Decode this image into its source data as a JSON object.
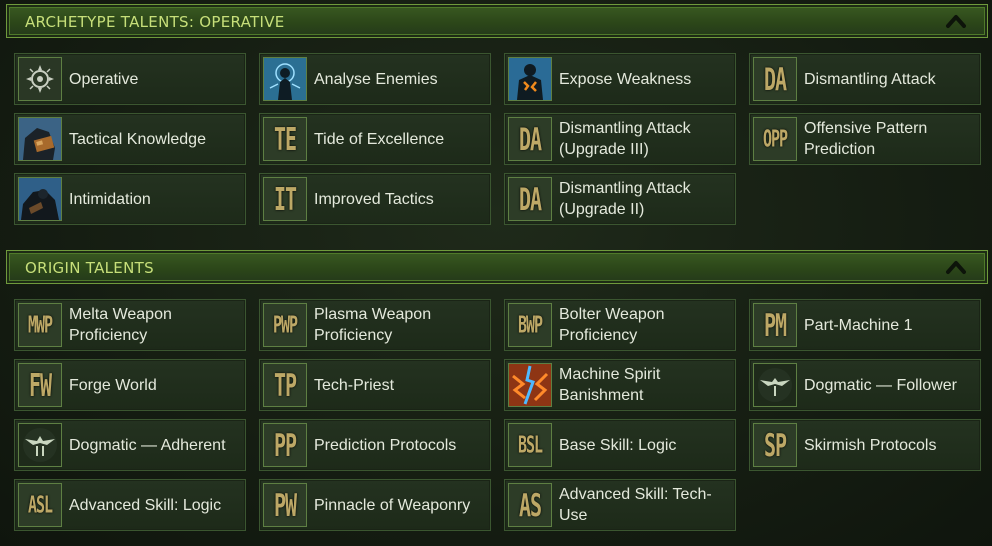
{
  "sections": [
    {
      "title": "ARCHETYPE TALENTS: OPERATIVE",
      "collapse_icon": "chevron-up-icon",
      "rows": [
        [
          {
            "label": "Operative",
            "abbr": "",
            "icon": "operative-emblem-icon"
          },
          {
            "label": "Analyse Enemies",
            "abbr": "",
            "icon": "analyse-enemies-icon"
          },
          {
            "label": "Expose Weakness",
            "abbr": "",
            "icon": "expose-weakness-icon"
          },
          {
            "label": "Dismantling Attack",
            "abbr": "DA",
            "icon": "placeholder-icon"
          }
        ],
        [
          {
            "label": "Tactical Knowledge",
            "abbr": "",
            "icon": "tactical-knowledge-icon"
          },
          {
            "label": "Tide of Excellence",
            "abbr": "TE",
            "icon": "placeholder-icon"
          },
          {
            "label": "Dismantling Attack (Upgrade III)",
            "abbr": "DA",
            "icon": "placeholder-icon"
          },
          {
            "label": "Offensive Pattern Prediction",
            "abbr": "OPP",
            "icon": "placeholder-icon"
          }
        ],
        [
          {
            "label": "Intimidation",
            "abbr": "",
            "icon": "intimidation-icon"
          },
          {
            "label": "Improved Tactics",
            "abbr": "IT",
            "icon": "placeholder-icon"
          },
          {
            "label": "Dismantling Attack (Upgrade II)",
            "abbr": "DA",
            "icon": "placeholder-icon"
          }
        ]
      ]
    },
    {
      "title": "ORIGIN TALENTS",
      "collapse_icon": "chevron-up-icon",
      "rows": [
        [
          {
            "label": "Melta Weapon Proficiency",
            "abbr": "MWP",
            "icon": "placeholder-icon"
          },
          {
            "label": "Plasma Weapon Proficiency",
            "abbr": "PWP",
            "icon": "placeholder-icon"
          },
          {
            "label": "Bolter Weapon Proficiency",
            "abbr": "BWP",
            "icon": "placeholder-icon"
          },
          {
            "label": "Part-Machine 1",
            "abbr": "PM",
            "icon": "placeholder-icon"
          }
        ],
        [
          {
            "label": "Forge World",
            "abbr": "FW",
            "icon": "placeholder-icon"
          },
          {
            "label": "Tech-Priest",
            "abbr": "TP",
            "icon": "placeholder-icon"
          },
          {
            "label": "Machine Spirit Banishment",
            "abbr": "",
            "icon": "machine-spirit-banishment-icon"
          },
          {
            "label": "Dogmatic — Follower",
            "abbr": "",
            "icon": "aquila-emblem-icon"
          }
        ],
        [
          {
            "label": "Dogmatic — Adherent",
            "abbr": "",
            "icon": "aquila-adherent-icon"
          },
          {
            "label": "Prediction Protocols",
            "abbr": "PP",
            "icon": "placeholder-icon"
          },
          {
            "label": "Base Skill: Logic",
            "abbr": "BSL",
            "icon": "placeholder-icon"
          },
          {
            "label": "Skirmish Protocols",
            "abbr": "SP",
            "icon": "placeholder-icon"
          }
        ],
        [
          {
            "label": "Advanced Skill: Logic",
            "abbr": "ASL",
            "icon": "placeholder-icon"
          },
          {
            "label": "Pinnacle of Weaponry",
            "abbr": "PW",
            "icon": "placeholder-icon"
          },
          {
            "label": "Advanced Skill: Tech-Use",
            "abbr": "AS",
            "icon": "placeholder-icon"
          }
        ]
      ]
    }
  ],
  "colors": {
    "header_text": "#c7df7a",
    "abbr_text": "#bda866",
    "tile_border": "#3b5630",
    "header_border": "#6f9a3c"
  }
}
